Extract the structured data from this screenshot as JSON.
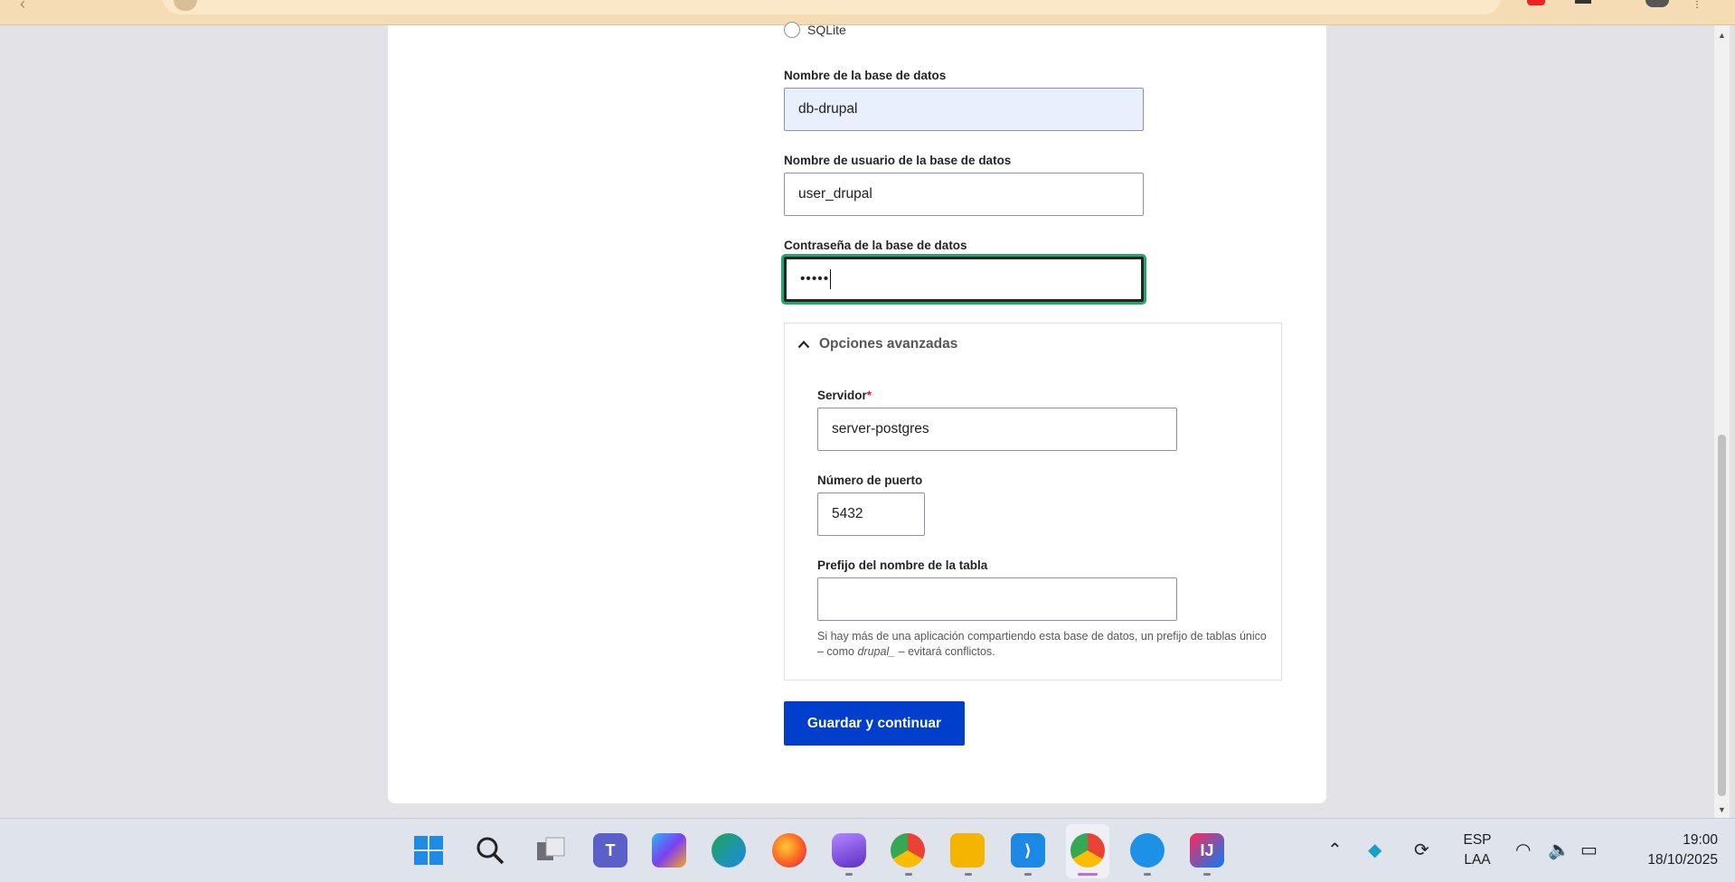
{
  "form": {
    "radio_sqlite_label": "SQLite",
    "db_name": {
      "label": "Nombre de la base de datos",
      "value": "db-drupal"
    },
    "db_user": {
      "label": "Nombre de usuario de la base de datos",
      "value": "user_drupal"
    },
    "db_password": {
      "label": "Contraseña de la base de datos",
      "masked_value": "•••••"
    },
    "advanced": {
      "summary": "Opciones avanzadas",
      "host": {
        "label": "Servidor",
        "required_mark": "*",
        "value": "server-postgres"
      },
      "port": {
        "label": "Número de puerto",
        "value": "5432"
      },
      "prefix": {
        "label": "Prefijo del nombre de la tabla",
        "value": "",
        "help_part1": "Si hay más de una aplicación compartiendo esta base de datos, un prefijo de tablas único – como ",
        "help_em": "drupal_",
        "help_part2": " – evitará conflictos."
      }
    },
    "submit_label": "Guardar y continuar"
  },
  "taskbar": {
    "apps": [
      {
        "name": "start",
        "icon": "windows-icon"
      },
      {
        "name": "search",
        "icon": "search-icon"
      },
      {
        "name": "task-view",
        "icon": "task-view-icon"
      },
      {
        "name": "teams",
        "icon": "teams-icon"
      },
      {
        "name": "copilot",
        "icon": "copilot-icon"
      },
      {
        "name": "edge",
        "icon": "edge-icon"
      },
      {
        "name": "firefox",
        "icon": "firefox-icon"
      },
      {
        "name": "obsidian",
        "icon": "obsidian-icon"
      },
      {
        "name": "chrome-profile",
        "icon": "chrome-icon"
      },
      {
        "name": "file-explorer",
        "icon": "folder-icon"
      },
      {
        "name": "vscode",
        "icon": "vscode-icon"
      },
      {
        "name": "chrome",
        "icon": "chrome-icon"
      },
      {
        "name": "docker",
        "icon": "docker-icon"
      },
      {
        "name": "intellij",
        "icon": "intellij-icon"
      }
    ],
    "tray": {
      "language_top": "ESP",
      "language_bottom": "LAA",
      "time": "19:00",
      "date": "18/10/2025"
    }
  },
  "colors": {
    "submit_button": "#003ecc",
    "focus_ring": "#26a769",
    "autofill_bg": "#e8f0fe",
    "required": "#d72222"
  }
}
